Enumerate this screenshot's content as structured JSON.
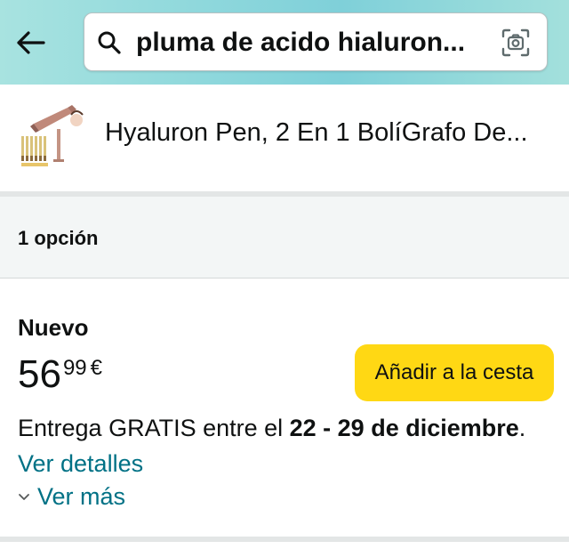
{
  "search": {
    "query": "pluma de acido hialuron..."
  },
  "product": {
    "title": "Hyaluron Pen, 2 En 1 BolíGrafo De..."
  },
  "offers": {
    "count_label": "1 opción"
  },
  "offer": {
    "condition": "Nuevo",
    "price_whole": "56",
    "price_fraction": "99",
    "currency_symbol": "€",
    "add_to_cart_label": "Añadir a la cesta",
    "delivery_prefix": "Entrega GRATIS entre el ",
    "delivery_dates": "22 - 29 de diciembre",
    "delivery_suffix": ". ",
    "details_link": "Ver detalles",
    "more_label": "Ver más"
  },
  "colors": {
    "add_button": "#ffd814",
    "link": "#007185",
    "header_gradient_start": "#a8e3e0",
    "header_gradient_end": "#7fd0d9"
  },
  "icons": [
    "back-arrow-icon",
    "search-icon",
    "camera-icon",
    "chevron-down-icon"
  ]
}
